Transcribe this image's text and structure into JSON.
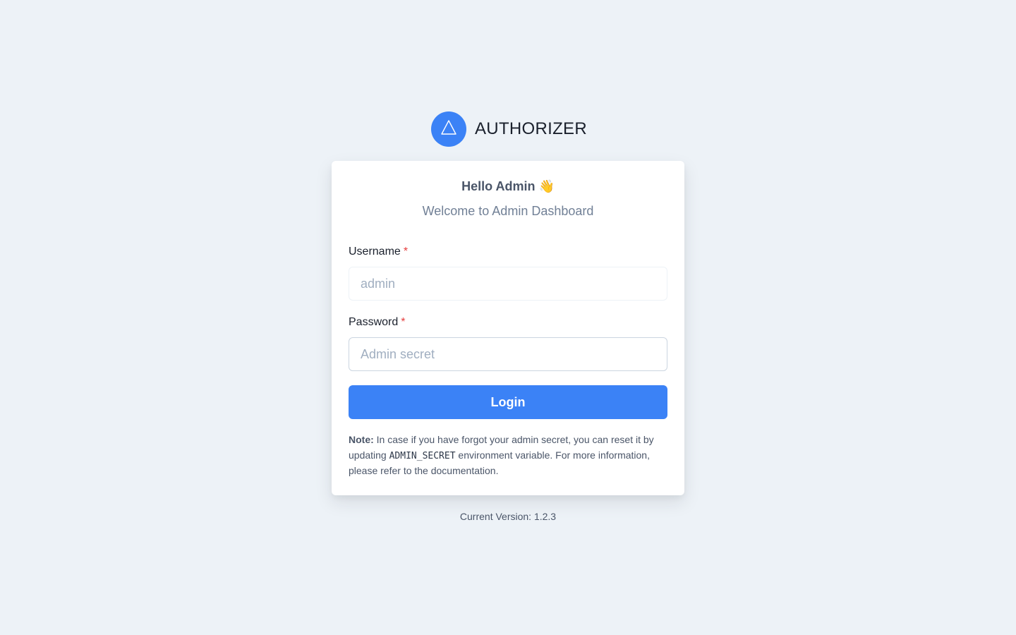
{
  "brand": {
    "name": "AUTHORIZER",
    "logo_icon": "triangle-icon",
    "accent_color": "#3b82f6"
  },
  "header": {
    "greeting": "Hello Admin 👋",
    "subtitle": "Welcome to Admin Dashboard"
  },
  "form": {
    "username": {
      "label": "Username",
      "required_mark": "*",
      "placeholder": "admin",
      "value": ""
    },
    "password": {
      "label": "Password",
      "required_mark": "*",
      "placeholder": "Admin secret",
      "value": ""
    },
    "login_label": "Login"
  },
  "note": {
    "prefix": "Note:",
    "text_before_code": " In case if you have forgot your admin secret, you can reset it by updating ",
    "code": "ADMIN_SECRET",
    "text_after_code": " environment variable. For more information, please refer to the documentation."
  },
  "footer": {
    "version_text": "Current Version: 1.2.3"
  }
}
